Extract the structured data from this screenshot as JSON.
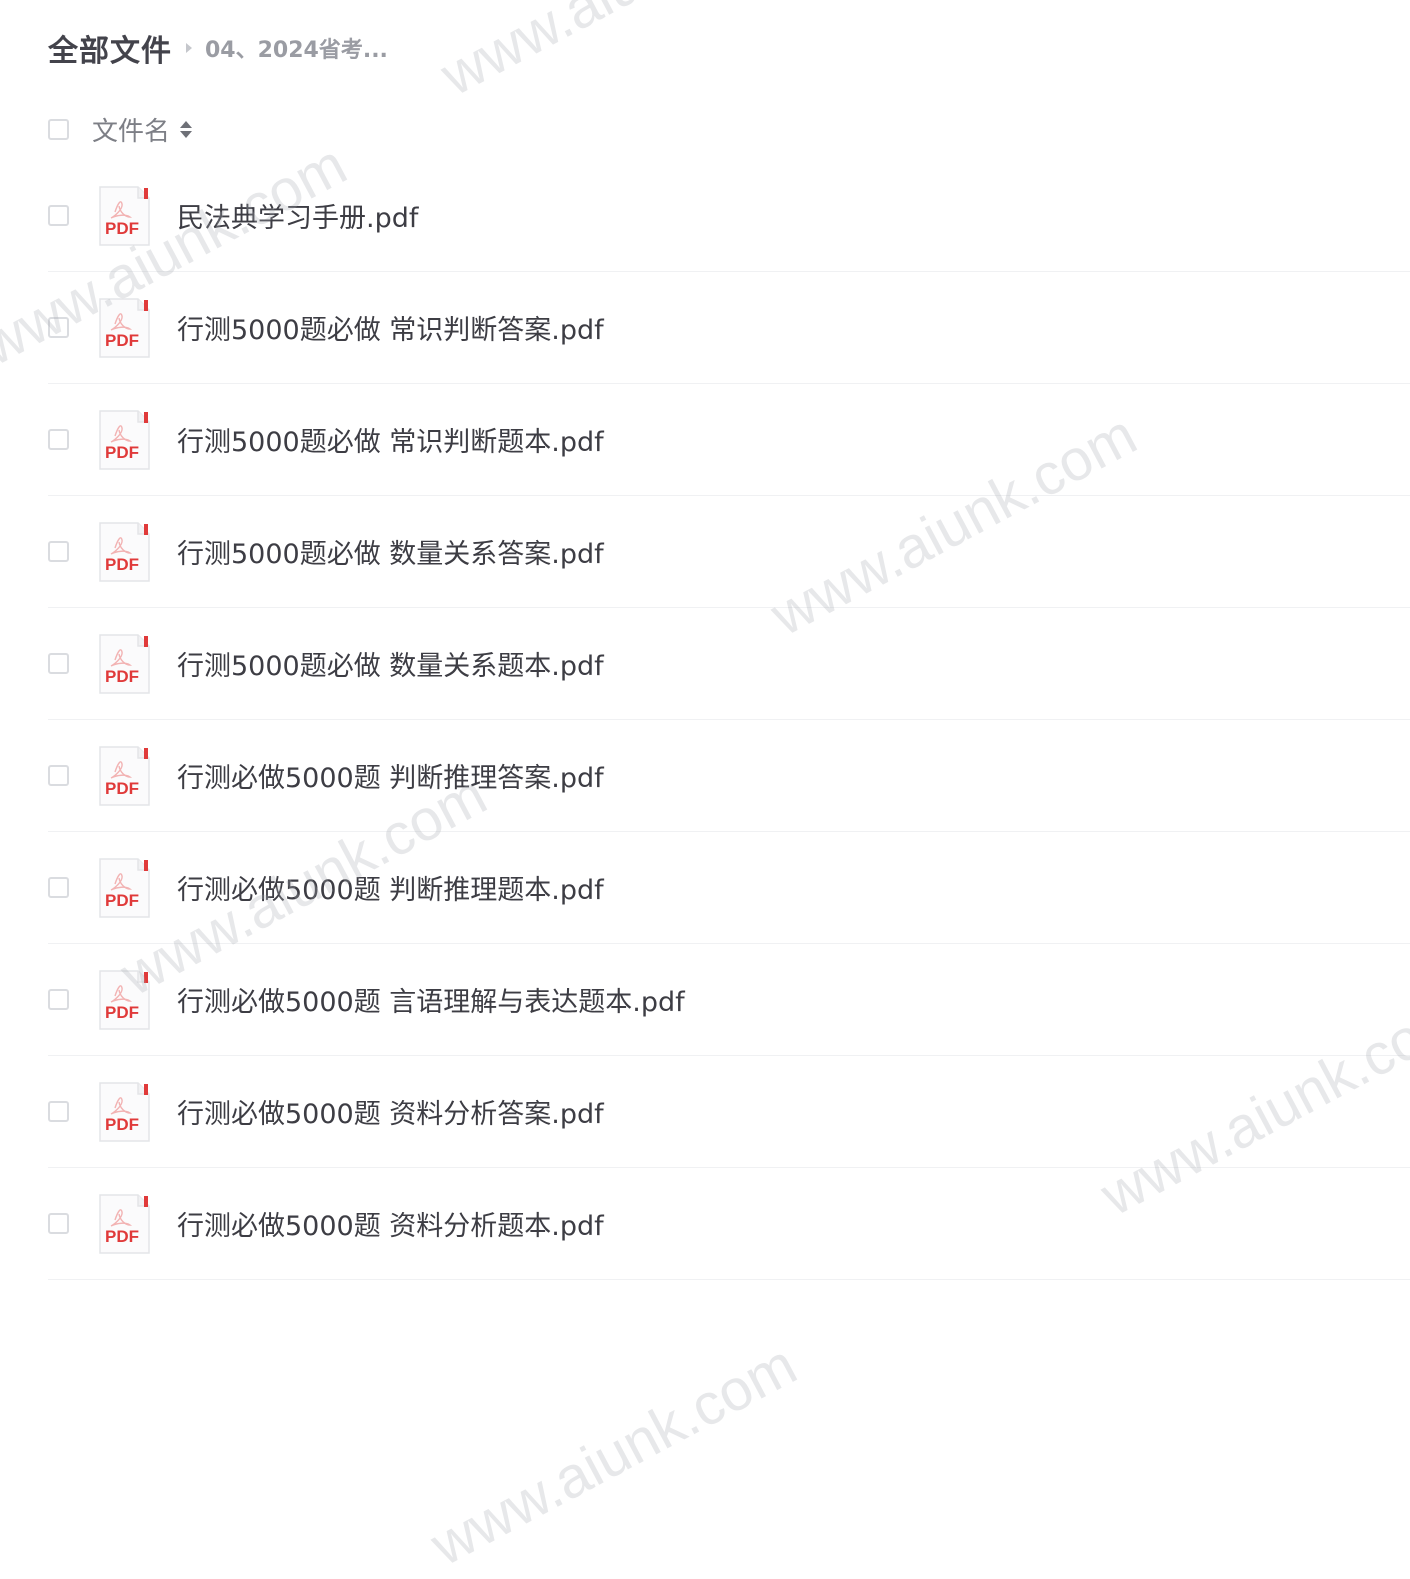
{
  "breadcrumb": {
    "root": "全部文件",
    "current": "04、2024省考..."
  },
  "list_header": {
    "name_column": "文件名"
  },
  "pdf_badge": "PDF",
  "files": [
    {
      "name": "民法典学习手册.pdf"
    },
    {
      "name": "行测5000题必做 常识判断答案.pdf"
    },
    {
      "name": "行测5000题必做 常识判断题本.pdf"
    },
    {
      "name": "行测5000题必做 数量关系答案.pdf"
    },
    {
      "name": "行测5000题必做 数量关系题本.pdf"
    },
    {
      "name": "行测必做5000题 判断推理答案.pdf"
    },
    {
      "name": "行测必做5000题 判断推理题本.pdf"
    },
    {
      "name": "行测必做5000题 言语理解与表达题本.pdf"
    },
    {
      "name": "行测必做5000题 资料分析答案.pdf"
    },
    {
      "name": "行测必做5000题 资料分析题本.pdf"
    }
  ],
  "watermark_text": "www.aiunk.com",
  "colors": {
    "pdf_red": "#e03a3a",
    "divider": "#f0f1f3",
    "text": "#3d3d44"
  }
}
